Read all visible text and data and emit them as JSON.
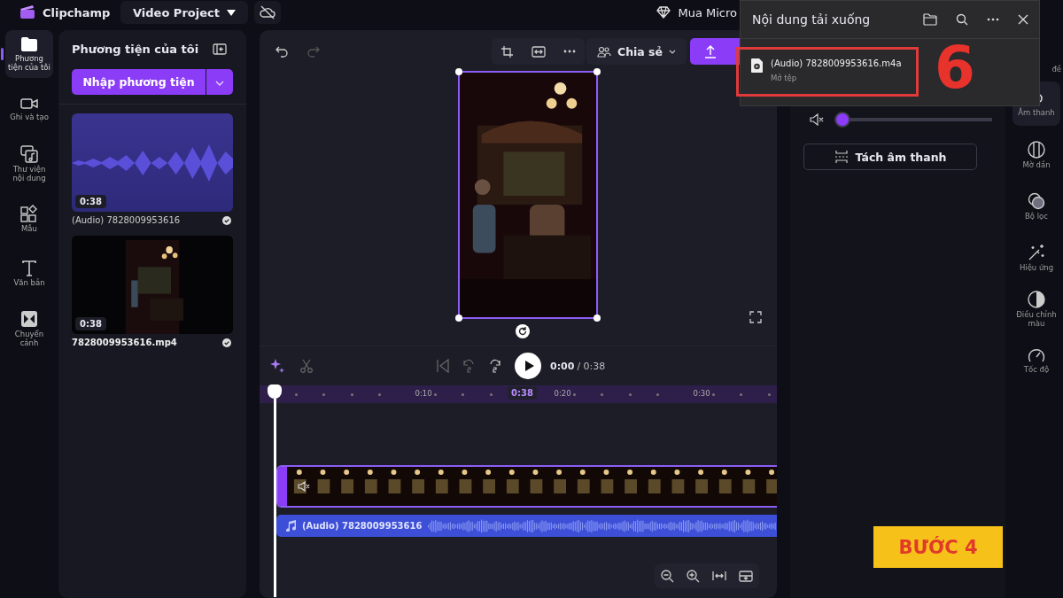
{
  "app": {
    "name": "Clipchamp",
    "project": "Video Project",
    "promo": "Mua Micro"
  },
  "left_nav": [
    {
      "label": "Phương tiện của tôi",
      "selected": true
    },
    {
      "label": "Ghi và tạo",
      "selected": false
    },
    {
      "label": "Thư viện nội dung",
      "selected": false
    },
    {
      "label": "Mẫu",
      "selected": false
    },
    {
      "label": "Văn bản",
      "selected": false
    },
    {
      "label": "Chuyển cảnh",
      "selected": false
    }
  ],
  "media_panel": {
    "title": "Phương tiện của tôi",
    "import_button": "Nhập phương tiện",
    "items": [
      {
        "kind": "audio",
        "duration": "0:38",
        "name": "(Audio) 7828009953616"
      },
      {
        "kind": "video",
        "duration": "0:38",
        "name": "7828009953616.mp4"
      }
    ]
  },
  "editor": {
    "share_button": "Chia sẻ",
    "time_current": "0:00",
    "time_total": "/ 0:38",
    "ruler_ticks": [
      "0:10",
      "0:20",
      "0:30"
    ],
    "playhead_time": "0:38",
    "audio_clip": "(Audio) 7828009953616"
  },
  "downloads": {
    "title": "Nội dung tải xuống",
    "file": "(Audio) 7828009953616.m4a",
    "action": "Mở tệp"
  },
  "audio_panel": {
    "volume": {
      "level": 0
    },
    "split_button": "Tách âm thanh"
  },
  "right_nav": [
    {
      "label": "đề",
      "selected": false
    },
    {
      "label": "Âm thanh",
      "selected": true
    },
    {
      "label": "Mờ dần",
      "selected": false
    },
    {
      "label": "Bộ lọc",
      "selected": false
    },
    {
      "label": "Hiệu ứng",
      "selected": false
    },
    {
      "label": "Điều chỉnh màu",
      "selected": false
    },
    {
      "label": "Tốc độ",
      "selected": false
    }
  ],
  "annotations": {
    "step_number": "6",
    "step_label": "BƯỚC 4"
  }
}
